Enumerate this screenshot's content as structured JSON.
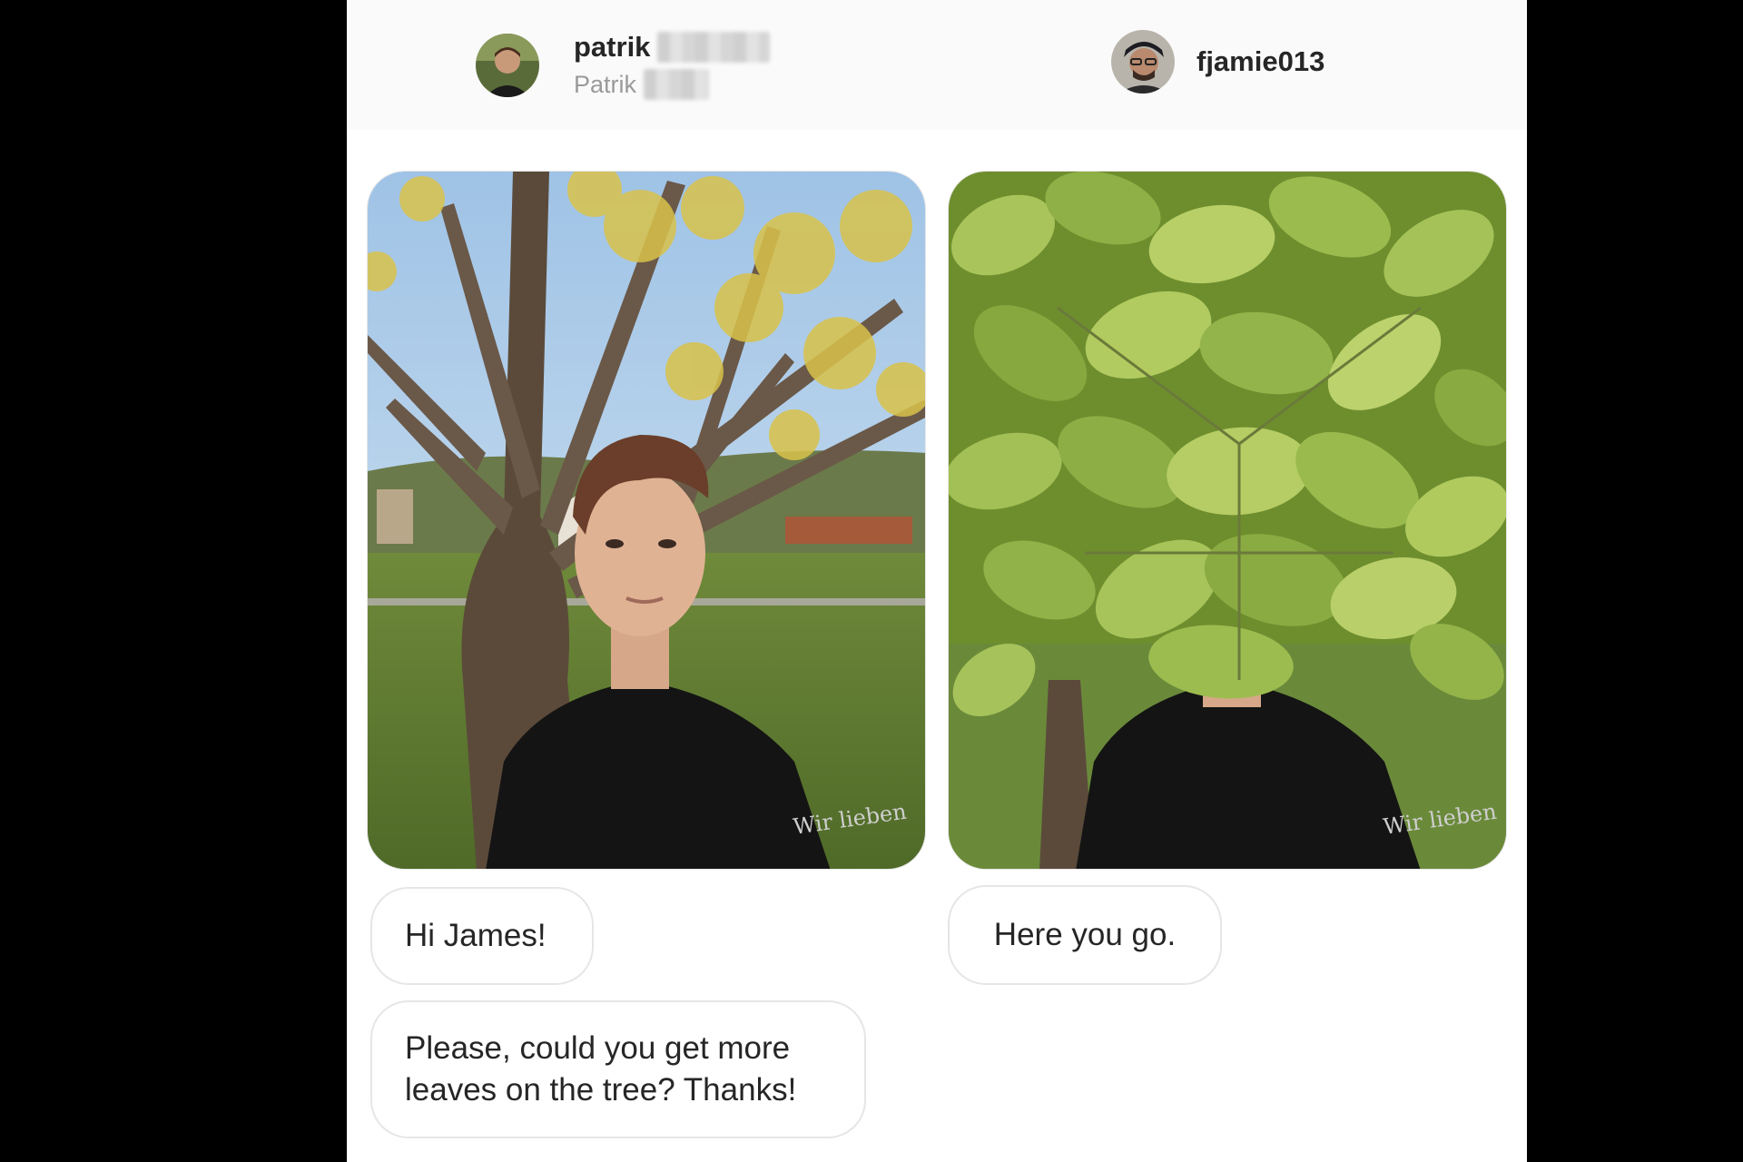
{
  "conversation": {
    "left_user": {
      "username": "patrik",
      "full_name": "Patrik",
      "avatar_icon": "user-avatar"
    },
    "right_user": {
      "username": "fjamie013",
      "avatar_icon": "user-avatar"
    },
    "left_photo": {
      "shirt_text": "Wir lieben"
    },
    "right_photo": {
      "shirt_text": "Wir lieben"
    },
    "messages_left": [
      "Hi James!",
      "Please, could you get more leaves on the tree? Thanks!"
    ],
    "messages_right": [
      "Here you go."
    ]
  },
  "colors": {
    "page_background": "#000000",
    "panel_background": "#ffffff",
    "header_background": "#fafafa",
    "username_text": "#262626",
    "secondary_text": "#9a9a9a",
    "bubble_border": "#e6e6e6"
  }
}
